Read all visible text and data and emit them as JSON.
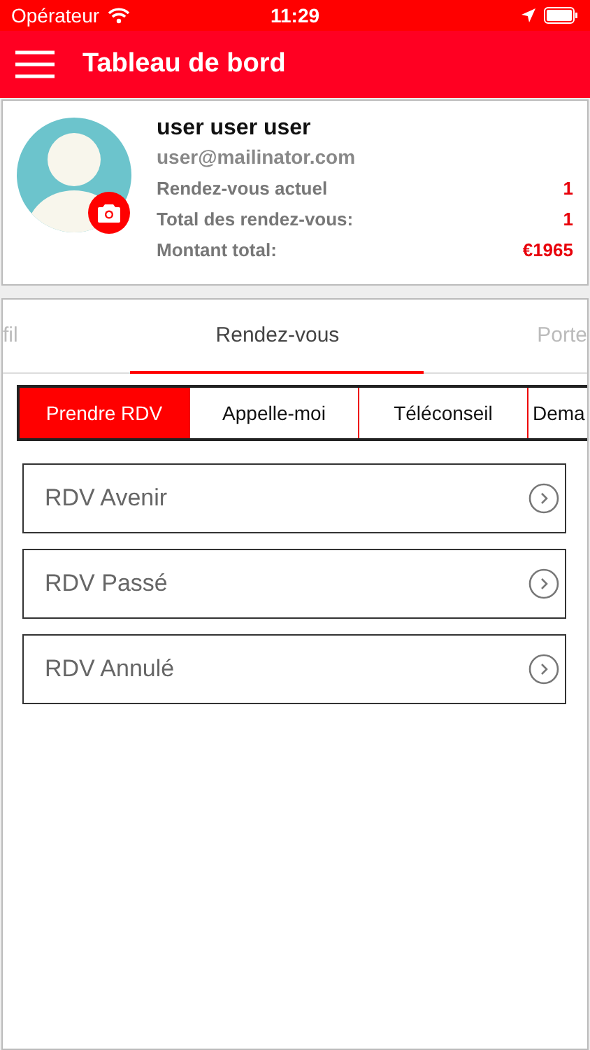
{
  "status_bar": {
    "carrier": "Opérateur",
    "time": "11:29"
  },
  "header": {
    "title": "Tableau de bord"
  },
  "profile": {
    "name": "user user user",
    "email": "user@mailinator.com",
    "stats": [
      {
        "label": "Rendez-vous actuel",
        "value": "1"
      },
      {
        "label": "Total des rendez-vous:",
        "value": "1"
      },
      {
        "label": "Montant total:",
        "value": "€1965"
      }
    ]
  },
  "tabs": [
    {
      "label": "fil",
      "selected": false
    },
    {
      "label": "Rendez-vous",
      "selected": true
    },
    {
      "label": "Porte",
      "selected": false
    }
  ],
  "segments": [
    {
      "label": "Prendre RDV",
      "selected": true
    },
    {
      "label": "Appelle-moi",
      "selected": false
    },
    {
      "label": "Téléconseil",
      "selected": false
    },
    {
      "label": "Dema",
      "selected": false
    }
  ],
  "items": [
    {
      "label": "RDV Avenir"
    },
    {
      "label": "RDV Passé"
    },
    {
      "label": "RDV Annulé"
    }
  ]
}
